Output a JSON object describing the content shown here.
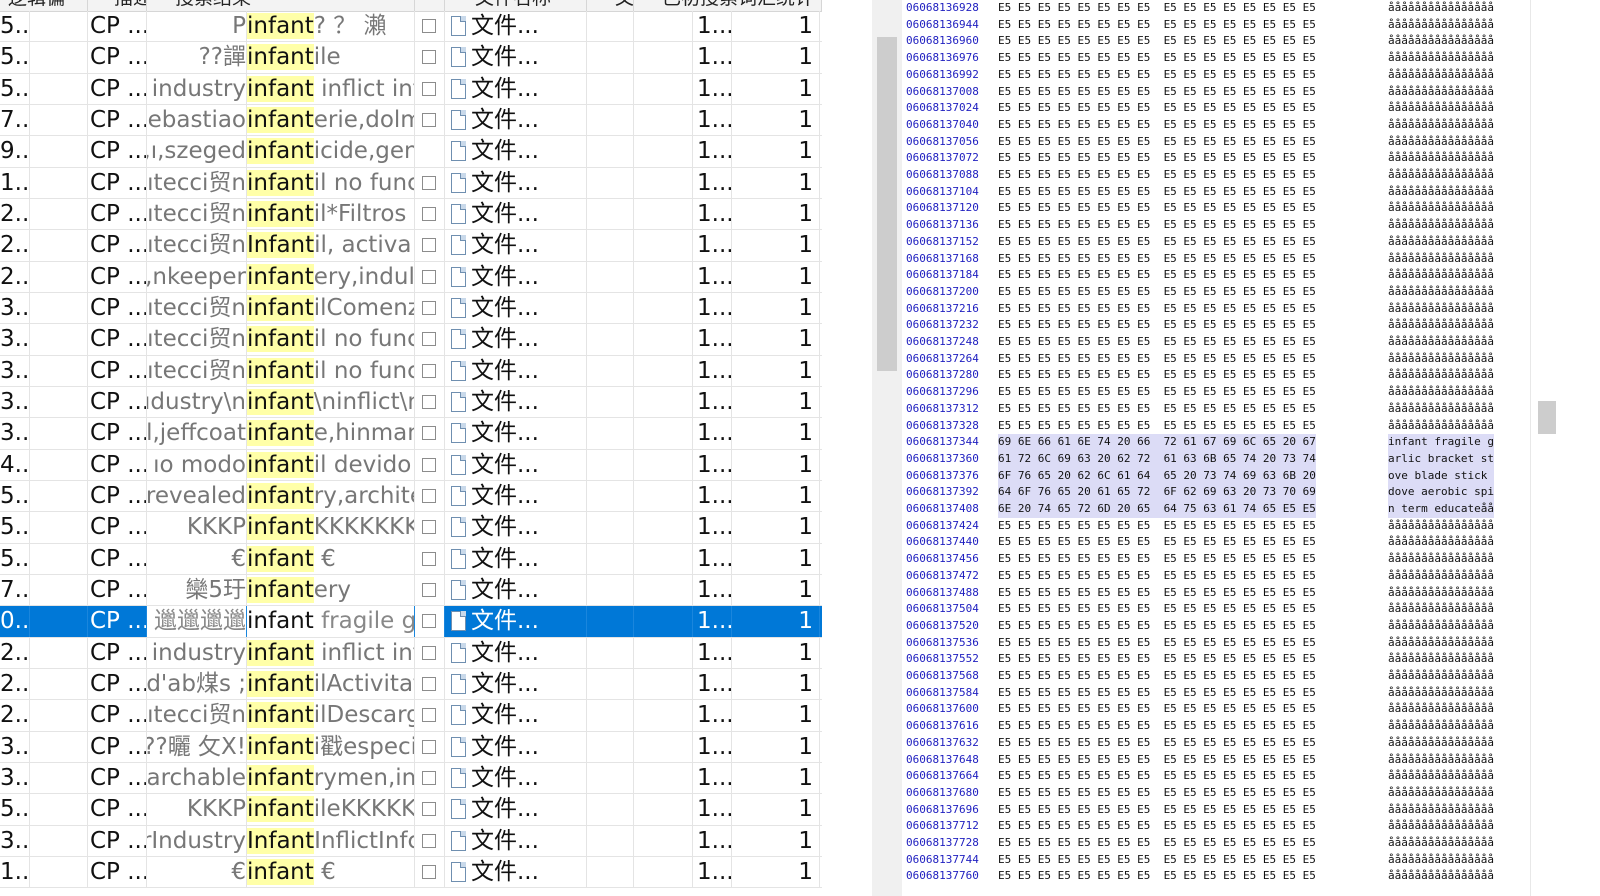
{
  "header": {
    "columns": [
      "逻辑偏",
      "描述",
      "搜索结果",
      "",
      "文件名称",
      "文",
      "已初搜索词汇统计"
    ]
  },
  "rows": [
    {
      "c0": "5...",
      "c1": "",
      "c2": "CP ...",
      "pre": "P",
      "hit": "infant",
      "post": "?      ？ 瀨 ",
      "check": true,
      "file": "文件...",
      "c7": "",
      "c8": "",
      "c9": "1...",
      "count": "1"
    },
    {
      "c0": "5...",
      "c1": "",
      "c2": "CP ...",
      "pre": "譂??",
      "hit": "infant",
      "post": "ile",
      "check": true,
      "file": "文件...",
      "c7": "",
      "c8": "",
      "c9": "1...",
      "count": "1"
    },
    {
      "c0": "5...",
      "c1": "",
      "c2": "CP ...",
      "pre": "industry ",
      "hit": "infant",
      "post": " inflict inf",
      "check": true,
      "file": "文件...",
      "c7": "",
      "c8": "",
      "c9": "1...",
      "count": "1"
    },
    {
      "c0": "7...",
      "c1": "",
      "c2": "CP ...",
      "pre": "ebastiao,",
      "hit": "infant",
      "post": "erie,dolm",
      "check": true,
      "file": "文件...",
      "c7": "",
      "c8": "",
      "c9": "1...",
      "count": "1"
    },
    {
      "c0": "9...",
      "c1": "",
      "c2": "CP ...",
      "pre": "ı,szeged,",
      "hit": "infant",
      "post": "icide,gen",
      "check": false,
      "file": "文件...",
      "c7": "",
      "c8": "",
      "c9": "1...",
      "count": "1"
    },
    {
      "c0": "1...",
      "c1": "",
      "c2": "CP ...",
      "pre": "ıtecci贸n ",
      "hit": "infant",
      "post": "il no func",
      "check": true,
      "file": "文件...",
      "c7": "",
      "c8": "",
      "c9": "1...",
      "count": "1"
    },
    {
      "c0": "2...",
      "c1": "",
      "c2": "CP ...",
      "pre": "ıtecci贸n ",
      "hit": "infant",
      "post": "il*Filtros c",
      "check": true,
      "file": "文件...",
      "c7": "",
      "c8": "",
      "c9": "1...",
      "count": "1"
    },
    {
      "c0": "2...",
      "c1": "",
      "c2": "CP ...",
      "pre": "ıtecci贸n ",
      "hit": "Infant",
      "post": "il, activa l",
      "check": true,
      "file": "文件...",
      "c7": "",
      "c8": "",
      "c9": "1...",
      "count": "1"
    },
    {
      "c0": "2...",
      "c1": "",
      "c2": "CP ...",
      "pre": "nkeeper,",
      "hit": "infant",
      "post": "ery,indulg",
      "check": true,
      "file": "文件...",
      "c7": "",
      "c8": "",
      "c9": "1...",
      "count": "1"
    },
    {
      "c0": "3...",
      "c1": "",
      "c2": "CP ...",
      "pre": "ıtecci贸n ",
      "hit": "infant",
      "post": "ilComenz",
      "check": true,
      "file": "文件...",
      "c7": "",
      "c8": "",
      "c9": "1...",
      "count": "1"
    },
    {
      "c0": "3...",
      "c1": "",
      "c2": "CP ...",
      "pre": "ıtecci贸n ",
      "hit": "infant",
      "post": "il no func",
      "check": true,
      "file": "文件...",
      "c7": "",
      "c8": "",
      "c9": "1...",
      "count": "1"
    },
    {
      "c0": "3...",
      "c1": "",
      "c2": "CP ...",
      "pre": "ıtecci贸n ",
      "hit": "infant",
      "post": "il no func",
      "check": true,
      "file": "文件...",
      "c7": "",
      "c8": "",
      "c9": "1...",
      "count": "1"
    },
    {
      "c0": "3...",
      "c1": "",
      "c2": "CP ...",
      "pre": "ıdustry\\n",
      "hit": "infant",
      "post": "\\ninflict\\n",
      "check": true,
      "file": "文件...",
      "c7": "",
      "c8": "",
      "c9": "1...",
      "count": "1"
    },
    {
      "c0": "3...",
      "c1": "",
      "c2": "CP ...",
      "pre": "l,jeffcoat,",
      "hit": "infant",
      "post": "e,hinman",
      "check": true,
      "file": "文件...",
      "c7": "",
      "c8": "",
      "c9": "1...",
      "count": "1"
    },
    {
      "c0": "4...",
      "c1": "",
      "c2": "CP ...",
      "pre": "ıo modo ",
      "hit": "infant",
      "post": "il devido",
      "check": true,
      "file": "文件...",
      "c7": "",
      "c8": "",
      "c9": "1...",
      "count": "1"
    },
    {
      "c0": "5...",
      "c1": "",
      "c2": "CP ...",
      "pre": "revealed,",
      "hit": "infant",
      "post": "ry,archite",
      "check": true,
      "file": "文件...",
      "c7": "",
      "c8": "",
      "c9": "1...",
      "count": "1"
    },
    {
      "c0": "5...",
      "c1": "",
      "c2": "CP ...",
      "pre": "KKKP",
      "hit": "infant",
      "post": "KKKKKKK",
      "check": true,
      "file": "文件...",
      "c7": "",
      "c8": "",
      "c9": "1...",
      "count": "1"
    },
    {
      "c0": "5...",
      "c1": "",
      "c2": "CP ...",
      "pre": "€",
      "hit": "infant",
      "post": "    €",
      "check": true,
      "file": "文件...",
      "c7": "",
      "c8": "",
      "c9": "1...",
      "count": "1"
    },
    {
      "c0": "7...",
      "c1": "",
      "c2": "CP ...",
      "pre": "欒5玗",
      "hit": "infant",
      "post": "ery",
      "check": true,
      "file": "文件...",
      "c7": "",
      "c8": "",
      "c9": "1...",
      "count": "1"
    },
    {
      "c0": "0...",
      "c1": "",
      "c2": "CP ...",
      "pre": "邋邋邋邋",
      "hit": "infant",
      "post": " fragile ga",
      "check": true,
      "file": "文件...",
      "c7": "",
      "c8": "",
      "c9": "1...",
      "count": "1",
      "selected": true
    },
    {
      "c0": "2...",
      "c1": "",
      "c2": "CP ...",
      "pre": "industry ",
      "hit": "infant",
      "post": " inflict inf",
      "check": true,
      "file": "文件...",
      "c7": "",
      "c8": "",
      "c9": "1...",
      "count": "1"
    },
    {
      "c0": "2...",
      "c1": "",
      "c2": "CP ...",
      "pre": "; d'ab煤s ",
      "hit": "infant",
      "post": "ilActivitat",
      "check": true,
      "file": "文件...",
      "c7": "",
      "c8": "",
      "c9": "1...",
      "count": "1"
    },
    {
      "c0": "2...",
      "c1": "",
      "c2": "CP ...",
      "pre": "ıtecci贸n ",
      "hit": "infant",
      "post": "ilDescarg",
      "check": true,
      "file": "文件...",
      "c7": "",
      "c8": "",
      "c9": "1...",
      "count": "1"
    },
    {
      "c0": "3...",
      "c1": "",
      "c2": "CP ...",
      "pre": "!曬 攵X??",
      "hit": "infant",
      "post": "i戳especi",
      "check": true,
      "file": "文件...",
      "c7": "",
      "c8": "",
      "c9": "1...",
      "count": "1"
    },
    {
      "c0": "3...",
      "c1": "",
      "c2": "CP ...",
      "pre": "archable,",
      "hit": "infant",
      "post": "rymen,in",
      "check": true,
      "file": "文件...",
      "c7": "",
      "c8": "",
      "c9": "1...",
      "count": "1"
    },
    {
      "c0": "5...",
      "c1": "",
      "c2": "CP ...",
      "pre": "KKKP",
      "hit": "infant",
      "post": "ileKKKKK",
      "check": true,
      "file": "文件...",
      "c7": "",
      "c8": "",
      "c9": "1...",
      "count": "1"
    },
    {
      "c0": "3...",
      "c1": "",
      "c2": "CP ...",
      "pre": "rIndustry",
      "hit": "Infant",
      "post": "InflictInfc",
      "check": true,
      "file": "文件...",
      "c7": "",
      "c8": "",
      "c9": "1...",
      "count": "1"
    },
    {
      "c0": "1...",
      "c1": "",
      "c2": "CP ...",
      "pre": "€",
      "hit": "infant",
      "post": "    €",
      "check": true,
      "file": "文件...",
      "c7": "",
      "c8": "",
      "c9": "1...",
      "count": "1"
    }
  ],
  "hex": {
    "filler_bytes": "E5 E5 E5 E5 E5 E5 E5 E5  E5 E5 E5 E5 E5 E5 E5 E5",
    "filler_ascii": "åååååååååååååååå",
    "lines": [
      {
        "addr": "06068136928"
      },
      {
        "addr": "06068136944"
      },
      {
        "addr": "06068136960"
      },
      {
        "addr": "06068136976"
      },
      {
        "addr": "06068136992"
      },
      {
        "addr": "06068137008"
      },
      {
        "addr": "06068137024"
      },
      {
        "addr": "06068137040"
      },
      {
        "addr": "06068137056"
      },
      {
        "addr": "06068137072"
      },
      {
        "addr": "06068137088"
      },
      {
        "addr": "06068137104"
      },
      {
        "addr": "06068137120"
      },
      {
        "addr": "06068137136"
      },
      {
        "addr": "06068137152"
      },
      {
        "addr": "06068137168"
      },
      {
        "addr": "06068137184"
      },
      {
        "addr": "06068137200"
      },
      {
        "addr": "06068137216"
      },
      {
        "addr": "06068137232"
      },
      {
        "addr": "06068137248"
      },
      {
        "addr": "06068137264"
      },
      {
        "addr": "06068137280"
      },
      {
        "addr": "06068137296"
      },
      {
        "addr": "06068137312"
      },
      {
        "addr": "06068137328"
      },
      {
        "addr": "06068137344",
        "bytes": "69 6E 66 61 6E 74 20 66  72 61 67 69 6C 65 20 67",
        "ascii": "infant fragile g",
        "sel": true
      },
      {
        "addr": "06068137360",
        "bytes": "61 72 6C 69 63 20 62 72  61 63 6B 65 74 20 73 74",
        "ascii": "arlic bracket st",
        "sel": true
      },
      {
        "addr": "06068137376",
        "bytes": "6F 76 65 20 62 6C 61 64  65 20 73 74 69 63 6B 20",
        "ascii": "ove blade stick ",
        "sel": true
      },
      {
        "addr": "06068137392",
        "bytes": "64 6F 76 65 20 61 65 72  6F 62 69 63 20 73 70 69",
        "ascii": "dove aerobic spi",
        "sel": true
      },
      {
        "addr": "06068137408",
        "bytes": "6E 20 74 65 72 6D 20 65  64 75 63 61 74 65 E5 E5",
        "ascii": "n term educateåå",
        "sel": true
      },
      {
        "addr": "06068137424"
      },
      {
        "addr": "06068137440"
      },
      {
        "addr": "06068137456"
      },
      {
        "addr": "06068137472"
      },
      {
        "addr": "06068137488"
      },
      {
        "addr": "06068137504"
      },
      {
        "addr": "06068137520"
      },
      {
        "addr": "06068137536"
      },
      {
        "addr": "06068137552"
      },
      {
        "addr": "06068137568"
      },
      {
        "addr": "06068137584"
      },
      {
        "addr": "06068137600"
      },
      {
        "addr": "06068137616"
      },
      {
        "addr": "06068137632"
      },
      {
        "addr": "06068137648"
      },
      {
        "addr": "06068137664"
      },
      {
        "addr": "06068137680"
      },
      {
        "addr": "06068137696"
      },
      {
        "addr": "06068137712"
      },
      {
        "addr": "06068137728"
      },
      {
        "addr": "06068137744"
      },
      {
        "addr": "06068137760"
      }
    ]
  }
}
